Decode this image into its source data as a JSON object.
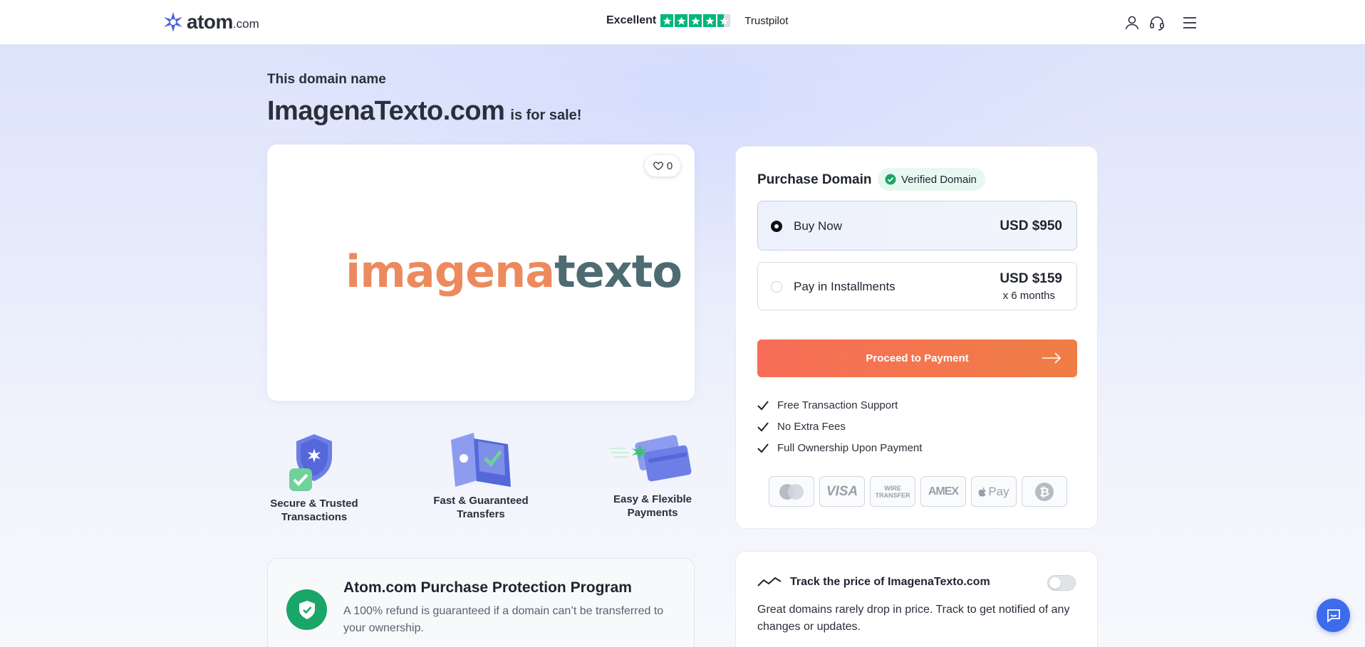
{
  "header": {
    "logo_text": "atom",
    "logo_suffix": ".com",
    "trust_label": "Excellent",
    "trust_rating_stars": 4.5,
    "trust_brand": "Trustpilot",
    "icons": [
      "user-icon",
      "headset-icon",
      "menu-icon"
    ]
  },
  "hero": {
    "intro": "This domain name",
    "domain": "ImagenaTexto.com",
    "sale_text": "is for sale!"
  },
  "logo_card": {
    "likes": "0",
    "brand_part1": "imagena",
    "brand_part2": "texto"
  },
  "features": [
    {
      "line1": "Secure & Trusted",
      "line2": "Transactions"
    },
    {
      "line1": "Fast & Guaranteed",
      "line2": "Transfers"
    },
    {
      "line1": "Easy & Flexible",
      "line2": "Payments"
    }
  ],
  "purchase": {
    "title": "Purchase Domain",
    "verified": "Verified Domain",
    "options": [
      {
        "label": "Buy Now",
        "price": "USD $950",
        "sub": ""
      },
      {
        "label": "Pay in Installments",
        "price": "USD $159",
        "sub": "x 6 months"
      }
    ],
    "cta": "Proceed to Payment",
    "benefits": [
      "Free Transaction Support",
      "No Extra Fees",
      "Full Ownership Upon Payment"
    ],
    "payment_methods": [
      "mastercard",
      "VISA",
      "WIRE TRANSFER",
      "AMEX",
      "Pay",
      "bitcoin"
    ]
  },
  "protection": {
    "title": "Atom.com Purchase Protection Program",
    "text": "A 100% refund is guaranteed if a domain can’t be transferred to your ownership."
  },
  "track": {
    "title": "Track the price of ImagenaTexto.com",
    "text": "Great domains rarely drop in price. Track to get notified of any changes or updates."
  },
  "colors": {
    "accent_orange": "#f76d57",
    "trust_green": "#00b67a",
    "protect_green": "#19a668",
    "chat_blue": "#3c6bec"
  }
}
